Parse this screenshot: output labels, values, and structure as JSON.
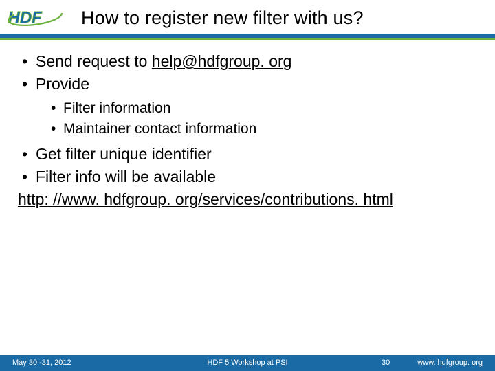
{
  "header": {
    "title": "How to register new filter with us?",
    "logo_text": "HDF"
  },
  "bullets": {
    "b1_prefix": "Send request to ",
    "b1_link": "help@hdfgroup. org",
    "b2": "Provide",
    "b2_sub1": "Filter information",
    "b2_sub2": "Maintainer contact information",
    "b3": "Get filter unique identifier",
    "b4": "Filter info will be available",
    "url": "http: //www. hdfgroup. org/services/contributions. html"
  },
  "footer": {
    "date": "May 30 -31, 2012",
    "event": "HDF 5 Workshop at PSI",
    "page": "30",
    "site": "www. hdfgroup. org"
  }
}
